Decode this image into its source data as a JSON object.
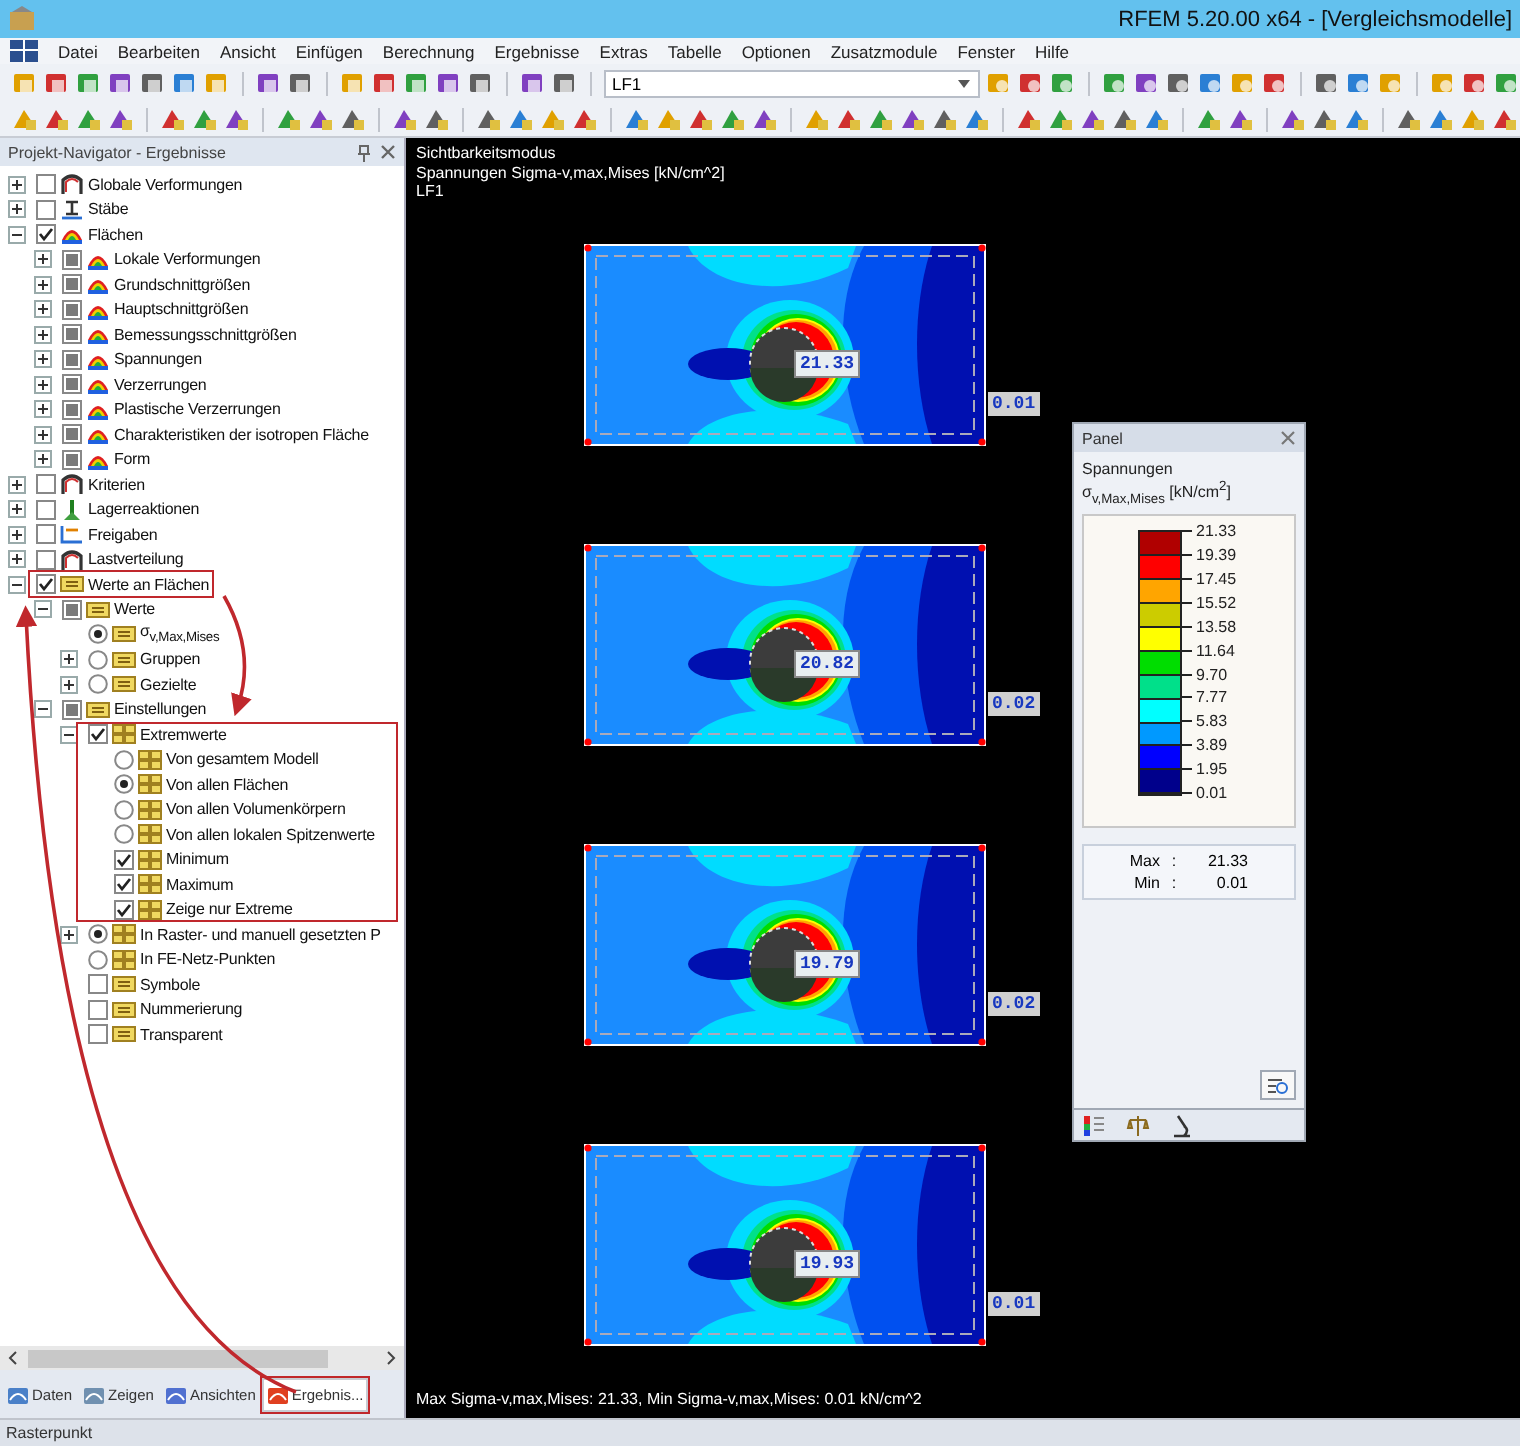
{
  "window": {
    "title": "RFEM 5.20.00 x64 - [Vergleichsmodelle]"
  },
  "menu": [
    "Datei",
    "Bearbeiten",
    "Ansicht",
    "Einfügen",
    "Berechnung",
    "Ergebnisse",
    "Extras",
    "Tabelle",
    "Optionen",
    "Zusatzmodule",
    "Fenster",
    "Hilfe"
  ],
  "toolbar": {
    "load_case": "LF1"
  },
  "navigator": {
    "title": "Projekt-Navigator - Ergebnisse",
    "tree": [
      {
        "label": "Globale Verformungen",
        "checked": false,
        "mixed": false,
        "kind": "deformation",
        "expanded": false
      },
      {
        "label": "Stäbe",
        "checked": false,
        "mixed": false,
        "kind": "member",
        "expanded": false
      },
      {
        "label": "Flächen",
        "checked": true,
        "mixed": false,
        "kind": "surface",
        "expanded": true,
        "children": [
          {
            "label": "Lokale Verformungen",
            "checked": false,
            "mixed": true,
            "kind": "surface",
            "expanded": false
          },
          {
            "label": "Grundschnittgrößen",
            "checked": false,
            "mixed": true,
            "kind": "surface",
            "expanded": false
          },
          {
            "label": "Hauptschnittgrößen",
            "checked": false,
            "mixed": true,
            "kind": "surface",
            "expanded": false
          },
          {
            "label": "Bemessungsschnittgrößen",
            "checked": false,
            "mixed": true,
            "kind": "surface",
            "expanded": false
          },
          {
            "label": "Spannungen",
            "checked": false,
            "mixed": true,
            "kind": "surface",
            "expanded": false
          },
          {
            "label": "Verzerrungen",
            "checked": false,
            "mixed": true,
            "kind": "surface",
            "expanded": false
          },
          {
            "label": "Plastische Verzerrungen",
            "checked": false,
            "mixed": true,
            "kind": "surface",
            "expanded": false
          },
          {
            "label": "Charakteristiken der isotropen Fläche",
            "checked": false,
            "mixed": true,
            "kind": "surface",
            "expanded": false
          },
          {
            "label": "Form",
            "checked": false,
            "mixed": true,
            "kind": "surface",
            "expanded": false
          }
        ]
      },
      {
        "label": "Kriterien",
        "checked": false,
        "mixed": false,
        "kind": "deformation",
        "expanded": false
      },
      {
        "label": "Lagerreaktionen",
        "checked": false,
        "mixed": false,
        "kind": "support",
        "expanded": false
      },
      {
        "label": "Freigaben",
        "checked": false,
        "mixed": false,
        "kind": "release",
        "expanded": false
      },
      {
        "label": "Lastverteilung",
        "checked": false,
        "mixed": false,
        "kind": "deformation",
        "expanded": false
      },
      {
        "label": "Werte an Flächen",
        "checked": true,
        "mixed": false,
        "kind": "values",
        "expanded": true,
        "highlighted": true,
        "children": [
          {
            "label": "Werte",
            "checked": false,
            "mixed": true,
            "kind": "values",
            "expanded": true,
            "children": [
              {
                "label": "σ$_{v,Max,Mises}$",
                "selected": true,
                "kind": "values"
              },
              {
                "label": "Gruppen",
                "selected": false,
                "kind": "values",
                "expanded": false
              },
              {
                "label": "Gezielte",
                "selected": false,
                "kind": "values",
                "expanded": false
              }
            ]
          },
          {
            "label": "Einstellungen",
            "checked": false,
            "mixed": true,
            "kind": "values",
            "expanded": true,
            "children": [
              {
                "label": "Extremwerte",
                "checked": true,
                "mixed": false,
                "kind": "grid",
                "expanded": true,
                "branch_highlighted": true,
                "children": [
                  {
                    "label": "Von gesamtem Modell",
                    "selected": false,
                    "kind": "grid"
                  },
                  {
                    "label": "Von allen Flächen",
                    "selected": true,
                    "kind": "grid"
                  },
                  {
                    "label": "Von allen Volumenkörpern",
                    "selected": false,
                    "kind": "grid"
                  },
                  {
                    "label": "Von allen lokalen Spitzenwerte",
                    "selected": false,
                    "kind": "grid"
                  },
                  {
                    "label": "Minimum",
                    "checked": true,
                    "mixed": false,
                    "kind": "grid"
                  },
                  {
                    "label": "Maximum",
                    "checked": true,
                    "mixed": false,
                    "kind": "grid"
                  },
                  {
                    "label": "Zeige nur Extreme",
                    "checked": true,
                    "mixed": false,
                    "kind": "grid"
                  }
                ]
              },
              {
                "label": "In Raster- und manuell gesetzten P",
                "selected": true,
                "kind": "grid",
                "expanded": false
              },
              {
                "label": "In FE-Netz-Punkten",
                "selected": false,
                "kind": "grid"
              },
              {
                "label": "Symbole",
                "checked": false,
                "mixed": false,
                "kind": "values"
              },
              {
                "label": "Nummerierung",
                "checked": false,
                "mixed": false,
                "kind": "values"
              },
              {
                "label": "Transparent",
                "checked": false,
                "mixed": false,
                "kind": "values"
              }
            ]
          }
        ]
      }
    ],
    "tabs": [
      {
        "label": "Daten",
        "selected": false
      },
      {
        "label": "Zeigen",
        "selected": false
      },
      {
        "label": "Ansichten",
        "selected": false
      },
      {
        "label": "Ergebnis...",
        "selected": true,
        "highlighted": true
      }
    ]
  },
  "view": {
    "info": [
      "Sichtbarkeitsmodus",
      "Spannungen Sigma-v,max,Mises [kN/cm^2]",
      "LF1"
    ],
    "plates": [
      {
        "max_label": "21.33",
        "min_label": "0.01"
      },
      {
        "max_label": "20.82",
        "min_label": "0.02"
      },
      {
        "max_label": "19.79",
        "min_label": "0.02"
      },
      {
        "max_label": "19.93",
        "min_label": "0.01"
      }
    ],
    "summary": "Max Sigma-v,max,Mises: 21.33, Min Sigma-v,max,Mises: 0.01 kN/cm^2"
  },
  "panel": {
    "title": "Panel",
    "quantity": "Spannungen",
    "unit_label": "σ$_{v,Max,Mises}$ [kN/cm$^{2}$]",
    "legend": {
      "bands": [
        {
          "color": "#b00000"
        },
        {
          "color": "#ff0000"
        },
        {
          "color": "#ffa500"
        },
        {
          "color": "#cccc00"
        },
        {
          "color": "#ffff00"
        },
        {
          "color": "#00dd00"
        },
        {
          "color": "#00e08a"
        },
        {
          "color": "#00ffff"
        },
        {
          "color": "#0099ff"
        },
        {
          "color": "#0000ff"
        },
        {
          "color": "#00008b"
        }
      ],
      "ticks": [
        "21.33",
        "19.39",
        "17.45",
        "15.52",
        "13.58",
        "11.64",
        "9.70",
        "7.77",
        "5.83",
        "3.89",
        "1.95",
        "0.01"
      ]
    },
    "extremes": [
      {
        "label": "Max",
        "separator": ":",
        "value": "21.33"
      },
      {
        "label": "Min",
        "separator": ":",
        "value": "0.01"
      }
    ]
  },
  "status_bar": "Rasterpunkt"
}
